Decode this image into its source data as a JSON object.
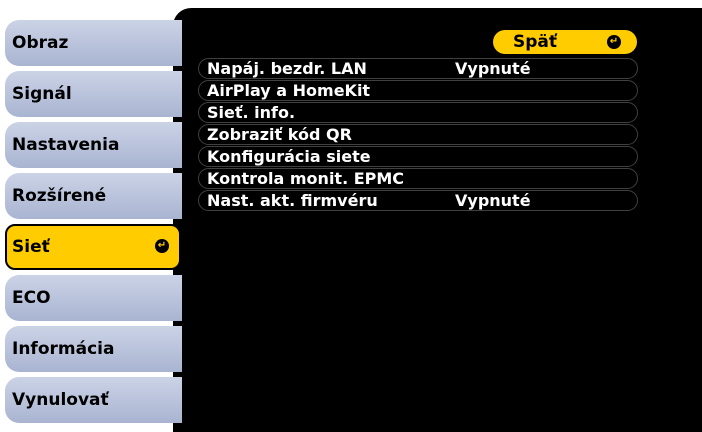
{
  "sidebar": {
    "items": [
      {
        "label": "Obraz"
      },
      {
        "label": "Signál"
      },
      {
        "label": "Nastavenia"
      },
      {
        "label": "Rozšírené"
      },
      {
        "label": "Sieť"
      },
      {
        "label": "ECO"
      },
      {
        "label": "Informácia"
      },
      {
        "label": "Vynulovať"
      }
    ],
    "selected_index": 4
  },
  "panel": {
    "back_label": "Späť",
    "rows": [
      {
        "label": "Napáj. bezdr. LAN",
        "value": "Vypnuté"
      },
      {
        "label": "AirPlay a HomeKit",
        "value": ""
      },
      {
        "label": "Sieť. info.",
        "value": ""
      },
      {
        "label": "Zobraziť kód QR",
        "value": ""
      },
      {
        "label": "Konfigurácia siete",
        "value": ""
      },
      {
        "label": "Kontrola monit. EPMC",
        "value": ""
      },
      {
        "label": "Nast. akt. firmvéru",
        "value": "Vypnuté"
      }
    ]
  },
  "colors": {
    "accent": "#ffcc00",
    "tab_bg": "#b8c2dc",
    "panel_bg": "#000000",
    "text_on_panel": "#ffffff"
  },
  "icons": {
    "enter": "enter-icon"
  }
}
